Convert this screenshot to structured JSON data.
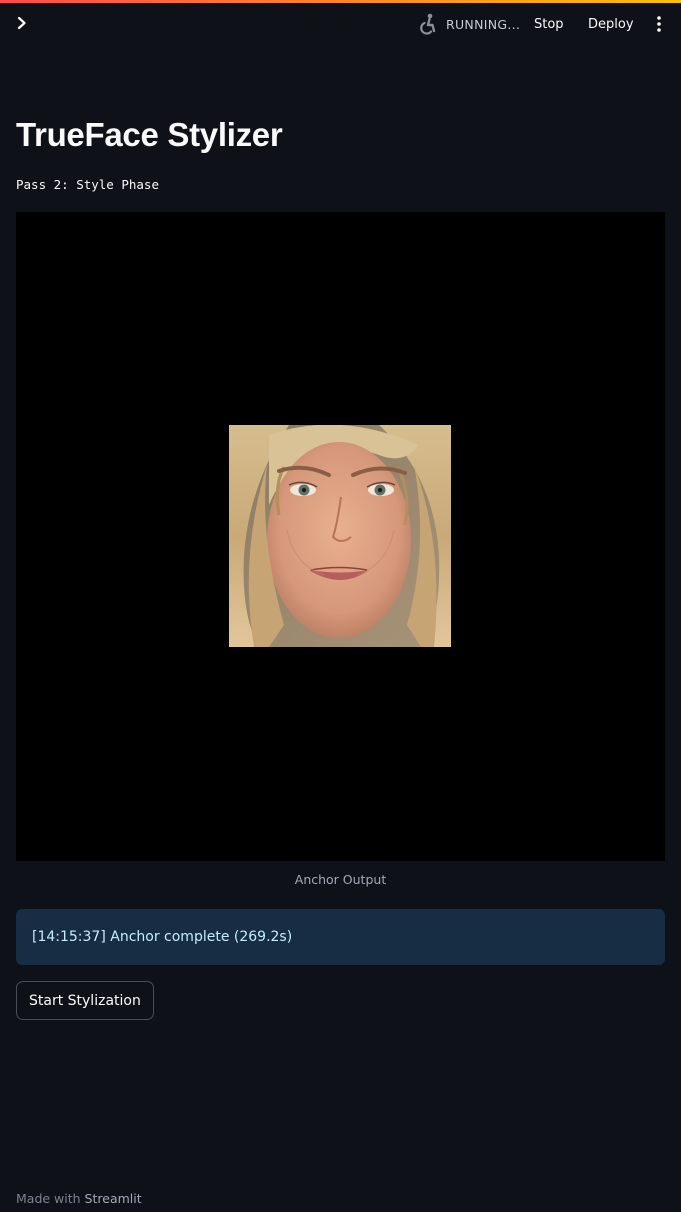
{
  "header": {
    "status_text": "RUNNING...",
    "stop_label": "Stop",
    "deploy_label": "Deploy",
    "status_icon": "running-figure-icon",
    "menu_icon": "kebab-menu-icon",
    "sidebar_icon": "chevron-right-icon"
  },
  "main": {
    "title": "TrueFace Stylizer",
    "phase_label": "Pass 2: Style Phase",
    "image_caption": "Anchor Output",
    "alert_text": "[14:15:37] Anchor complete (269.2s)",
    "start_button_label": "Start Stylization"
  },
  "footer": {
    "prefix": "Made with ",
    "link": "Streamlit"
  },
  "colors": {
    "background": "#0e1117",
    "alert_bg": "#172d43",
    "alert_text": "#c7ebff",
    "decoration_start": "#ff4b4b",
    "decoration_end": "#fdbf00"
  }
}
